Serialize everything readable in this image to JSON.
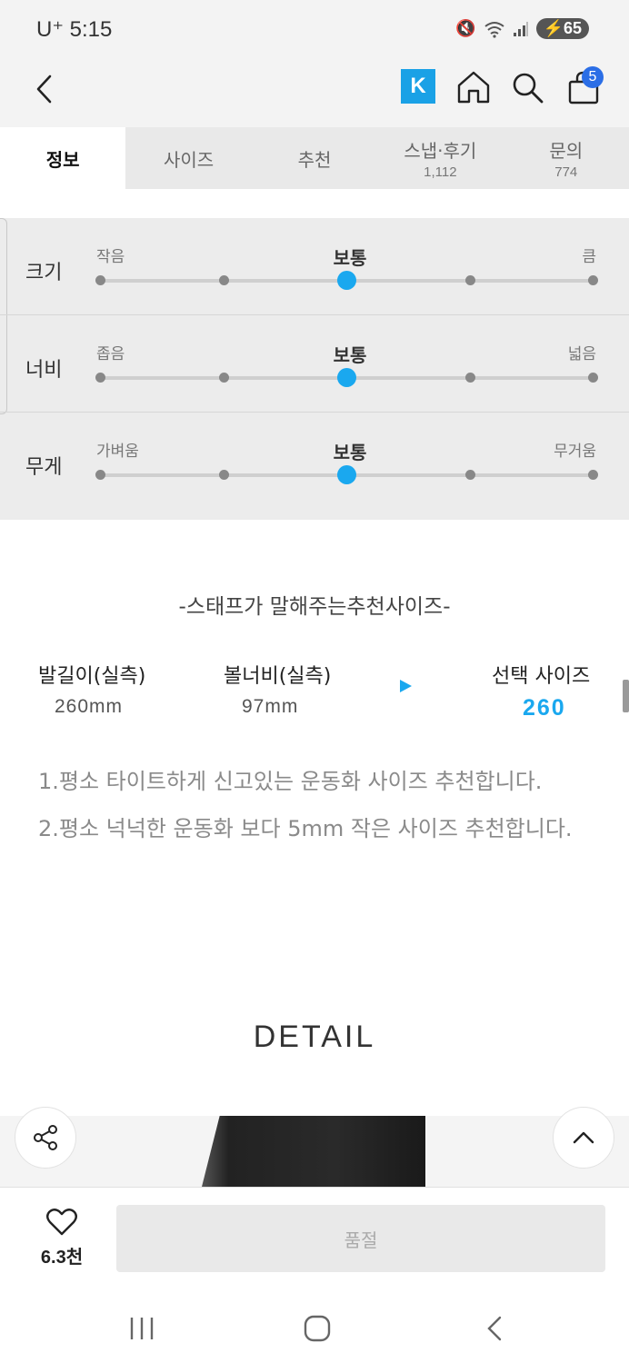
{
  "status_bar": {
    "time": "U⁺ 5:15",
    "battery": "65"
  },
  "nav": {
    "logo_letter": "K",
    "cart_badge": "5"
  },
  "tabs": [
    {
      "label": "정보",
      "count": "",
      "active": true
    },
    {
      "label": "사이즈",
      "count": ""
    },
    {
      "label": "추천",
      "count": ""
    },
    {
      "label": "스냅·후기",
      "count": "1,112"
    },
    {
      "label": "문의",
      "count": "774"
    }
  ],
  "size_feel": [
    {
      "label": "크기",
      "low": "작음",
      "mid": "보통",
      "high": "큼",
      "level": 3,
      "steps": 5
    },
    {
      "label": "너비",
      "low": "좁음",
      "mid": "보통",
      "high": "넓음",
      "level": 3,
      "steps": 5
    },
    {
      "label": "무게",
      "low": "가벼움",
      "mid": "보통",
      "high": "무거움",
      "level": 3,
      "steps": 5
    }
  ],
  "recommendation": {
    "title": "-스태프가 말해주는추천사이즈-",
    "foot_length_label": "발길이(실측)",
    "foot_length_value": "260mm",
    "foot_width_label": "볼너비(실측)",
    "foot_width_value": "97mm",
    "selected_label": "선택 사이즈",
    "selected_value": "260",
    "note1": "1.평소 타이트하게 신고있는 운동화 사이즈  추천합니다.",
    "note2": "2.평소 넉넉한 운동화 보다 5mm 작은 사이즈 추천합니다."
  },
  "detail": {
    "title": "DETAIL"
  },
  "bottom": {
    "like_count": "6.3천",
    "soldout_label": "품절"
  },
  "colors": {
    "accent": "#1aa8ef",
    "badge": "#2b6ee6",
    "logo": "#1aa1e6"
  }
}
